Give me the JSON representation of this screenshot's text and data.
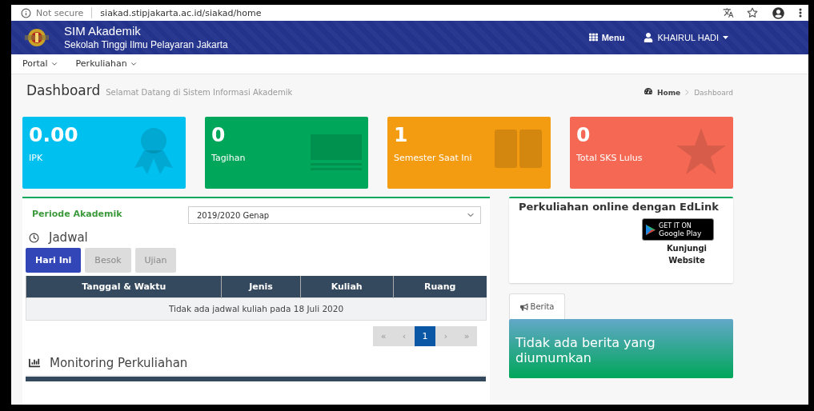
{
  "browser": {
    "security_label": "Not secure",
    "url": "siakad.stipjakarta.ac.id/siakad/home"
  },
  "header": {
    "title": "SIM Akademik",
    "subtitle": "Sekolah Tinggi Ilmu Pelayaran Jakarta",
    "menu_label": "Menu",
    "user": "KHAIRUL HADI"
  },
  "nav": [
    {
      "label": "Portal"
    },
    {
      "label": "Perkuliahan"
    }
  ],
  "page": {
    "title": "Dashboard",
    "subtitle": "Selamat Datang di Sistem Informasi Akademik",
    "breadcrumb": [
      {
        "label": "Home",
        "kind": "link"
      },
      {
        "label": "Dashboard",
        "kind": "current"
      }
    ]
  },
  "cards": [
    {
      "value": "0.00",
      "label": "IPK",
      "color": "#00c0ef",
      "kind": "ribbon"
    },
    {
      "value": "0",
      "label": "Tagihan",
      "color": "#00a65a",
      "kind": "money"
    },
    {
      "value": "1",
      "label": "Semester Saat Ini",
      "color": "#f39c12",
      "kind": "book"
    },
    {
      "value": "0",
      "label": "Total SKS Lulus",
      "color": "#f56954",
      "kind": "star"
    }
  ],
  "schedule": {
    "period_label": "Periode Akademik",
    "period_value": "2019/2020 Genap",
    "title": "Jadwal",
    "tabs": [
      {
        "label": "Hari Ini",
        "selected": true
      },
      {
        "label": "Besok",
        "selected": false
      },
      {
        "label": "Ujian",
        "selected": false
      }
    ],
    "columns": [
      "Tanggal & Waktu",
      "Jenis",
      "Kuliah",
      "Ruang"
    ],
    "empty_message": "Tidak ada jadwal kuliah pada 18 Juli 2020",
    "pagination": [
      {
        "label": "«",
        "selected": false
      },
      {
        "label": "‹",
        "selected": false
      },
      {
        "label": "1",
        "selected": true
      },
      {
        "label": "›",
        "selected": false
      },
      {
        "label": "»",
        "selected": false
      }
    ]
  },
  "monitoring": {
    "title": "Monitoring Perkuliahan"
  },
  "edlink": {
    "title": "Perkuliahan online dengan EdLink",
    "badge_small": "GET IT ON",
    "badge_large": "Google Play",
    "link": "Kunjungi Website"
  },
  "news": {
    "tab": "Berita",
    "message": "Tidak ada berita yang diumumkan"
  }
}
